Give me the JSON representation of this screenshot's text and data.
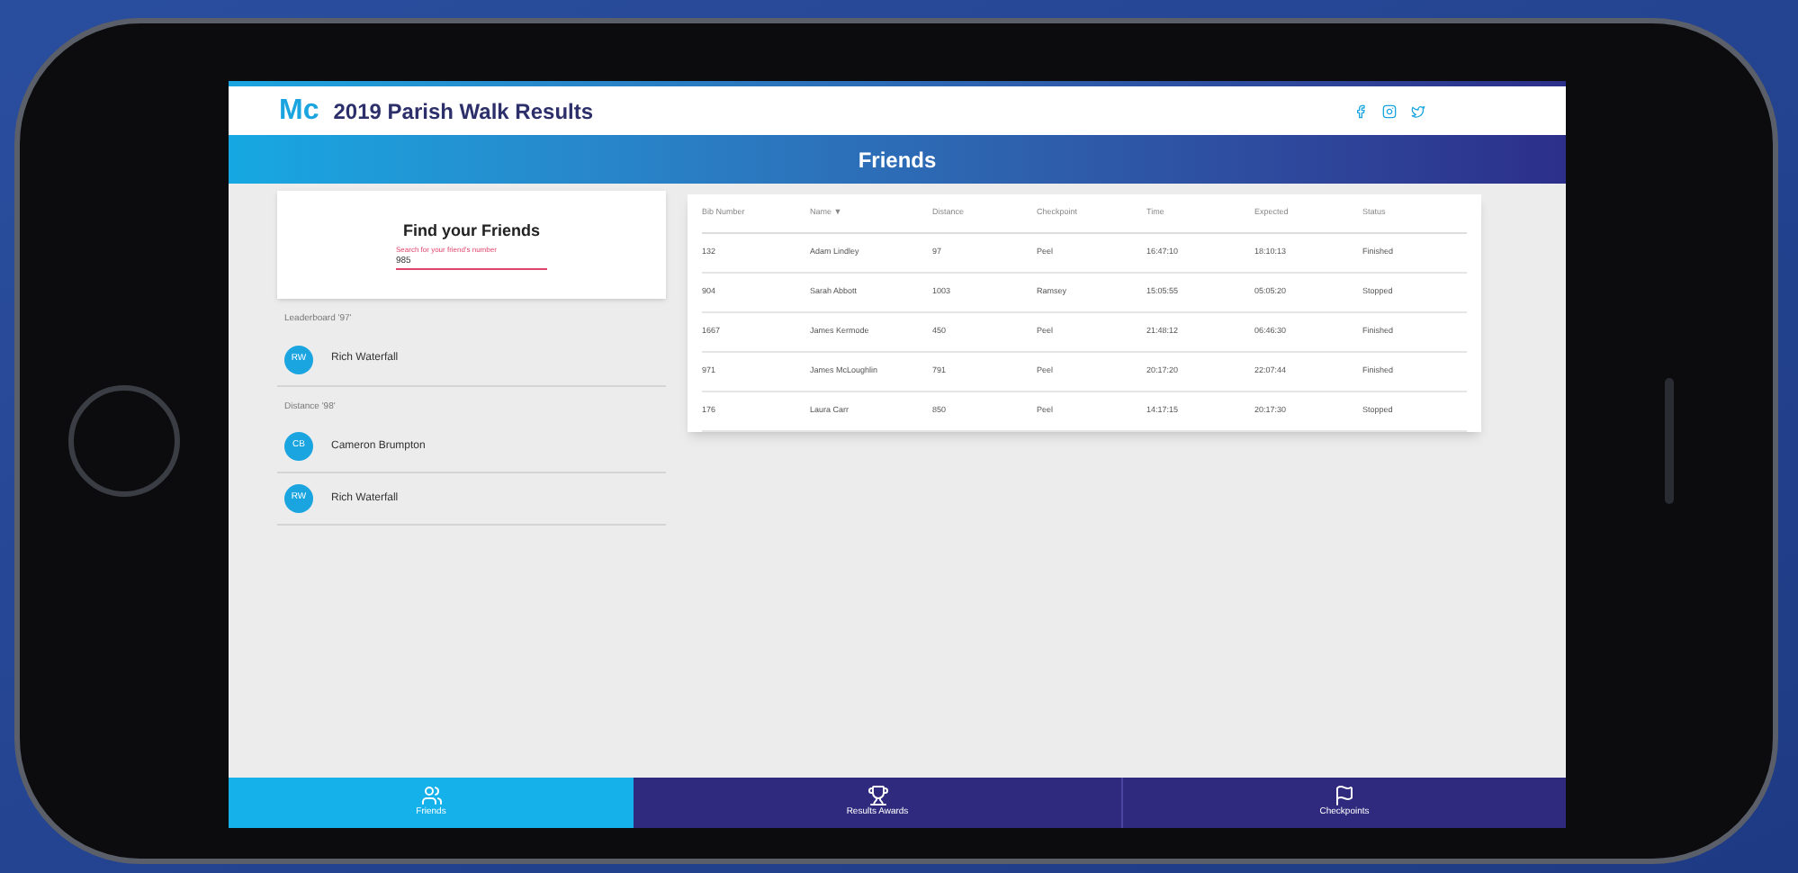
{
  "header": {
    "logo": "Mc",
    "title": "2019 Parish Walk Results"
  },
  "page_title": "Friends",
  "search": {
    "title": "Find your Friends",
    "label": "Search for your friend's number",
    "value": "985"
  },
  "groups": [
    {
      "label": "Leaderboard '97'",
      "friends": [
        {
          "initials": "RW",
          "name": "Rich Waterfall"
        }
      ]
    },
    {
      "label": "Distance '98'",
      "friends": [
        {
          "initials": "CB",
          "name": "Cameron Brumpton"
        },
        {
          "initials": "RW",
          "name": "Rich Waterfall"
        }
      ]
    }
  ],
  "table": {
    "columns": [
      "Bib Number",
      "Name ▼",
      "Distance",
      "Checkpoint",
      "Time",
      "Expected",
      "Status"
    ],
    "rows": [
      [
        "132",
        "Adam Lindley",
        "97",
        "Peel",
        "16:47:10",
        "18:10:13",
        "Finished"
      ],
      [
        "904",
        "Sarah Abbott",
        "1003",
        "Ramsey",
        "15:05:55",
        "05:05:20",
        "Stopped"
      ],
      [
        "1667",
        "James Kermode",
        "450",
        "Peel",
        "21:48:12",
        "06:46:30",
        "Finished"
      ],
      [
        "971",
        "James McLoughlin",
        "791",
        "Peel",
        "20:17:20",
        "22:07:44",
        "Finished"
      ],
      [
        "176",
        "Laura Carr",
        "850",
        "Peel",
        "14:17:15",
        "20:17:30",
        "Stopped"
      ]
    ]
  },
  "nav": [
    {
      "label": "Friends",
      "selected": true,
      "kind": "people"
    },
    {
      "label": "Results Awards",
      "selected": false,
      "kind": "trophy"
    },
    {
      "label": "Checkpoints",
      "selected": false,
      "kind": "flag"
    }
  ]
}
